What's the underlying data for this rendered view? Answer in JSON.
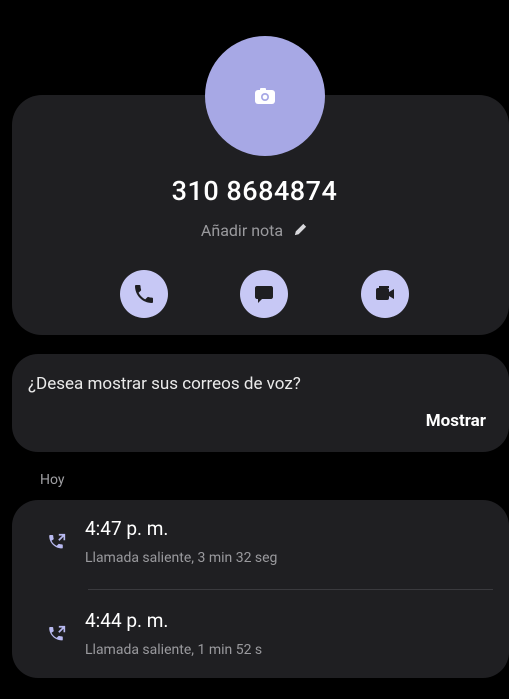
{
  "contact": {
    "number": "310 8684874",
    "note_label": "Añadir nota"
  },
  "actions": {
    "call": "call",
    "message": "message",
    "video": "video-call"
  },
  "voicemail": {
    "question": "¿Desea mostrar sus correos de voz?",
    "show_label": "Mostrar"
  },
  "history": {
    "section_label": "Hoy",
    "calls": [
      {
        "time": "4:47 p. m.",
        "detail": "Llamada saliente, 3 min 32 seg"
      },
      {
        "time": "4:44 p. m.",
        "detail": "Llamada saliente, 1 min 52 s"
      }
    ]
  },
  "colors": {
    "background": "#000000",
    "card": "#1f1f22",
    "avatar": "#a7a8e5",
    "action_button": "#c7c8f5",
    "accent_icon": "#b8b9f0"
  },
  "icons": {
    "avatar": "camera-icon",
    "note": "pencil-icon",
    "call": "phone-icon",
    "message": "chat-bubble-icon",
    "video": "video-camera-icon",
    "outgoing": "outgoing-call-icon"
  }
}
